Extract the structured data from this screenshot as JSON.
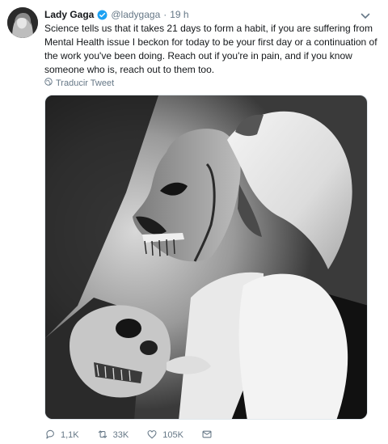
{
  "tweet": {
    "display_name": "Lady Gaga",
    "handle": "@ladygaga",
    "separator": "·",
    "time": "19 h",
    "text_lines": [
      "Science tells us that it takes 21 days to form a habit, if you are suffering from",
      "Mental Health issue I beckon for today to be your first day or a continuation of",
      "the work you've been doing. Reach out if you're in pain, and if you know",
      "someone who is, reach out to them too."
    ],
    "translate_label": "Traducir Tweet"
  },
  "actions": {
    "reply_count": "1,1K",
    "retweet_count": "33K",
    "like_count": "105K"
  },
  "colors": {
    "verified_blue": "#1da1f2",
    "secondary_text": "#657786"
  },
  "icons": [
    "verified-icon",
    "chevron-down-icon",
    "globe-icon",
    "reply-icon",
    "retweet-icon",
    "like-icon",
    "message-icon"
  ]
}
